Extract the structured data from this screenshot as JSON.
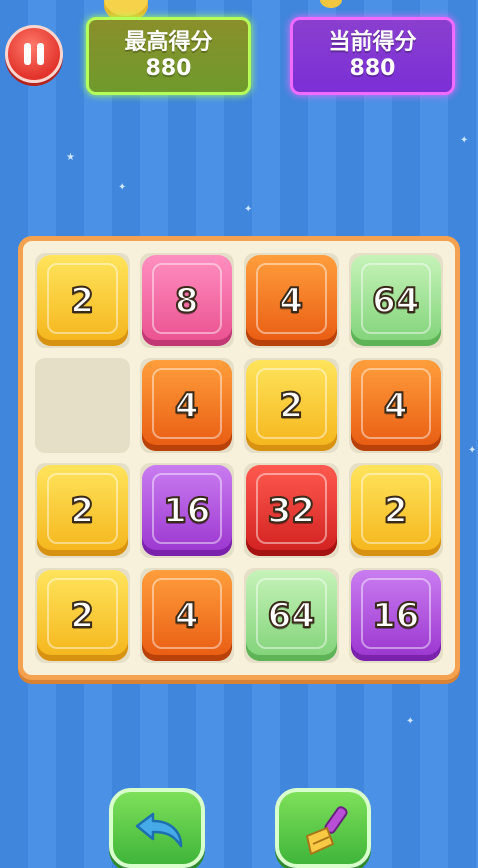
{
  "scores": {
    "best": {
      "label": "最高得分",
      "value": "880"
    },
    "current": {
      "label": "当前得分",
      "value": "880"
    }
  },
  "board": {
    "rows": [
      [
        "2",
        "8",
        "4",
        "64"
      ],
      [
        "",
        "4",
        "2",
        "4"
      ],
      [
        "2",
        "16",
        "32",
        "2"
      ],
      [
        "2",
        "4",
        "64",
        "16"
      ]
    ]
  },
  "colors": {
    "2": "#f4b41a",
    "4": "#e85a11",
    "8": "#e94f8e",
    "16": "#9a34cf",
    "32": "#d01f1f",
    "64": "#7fd277"
  },
  "icons": {
    "pause": "pause-icon",
    "undo": "undo-arrow-icon",
    "clear": "broom-icon"
  }
}
